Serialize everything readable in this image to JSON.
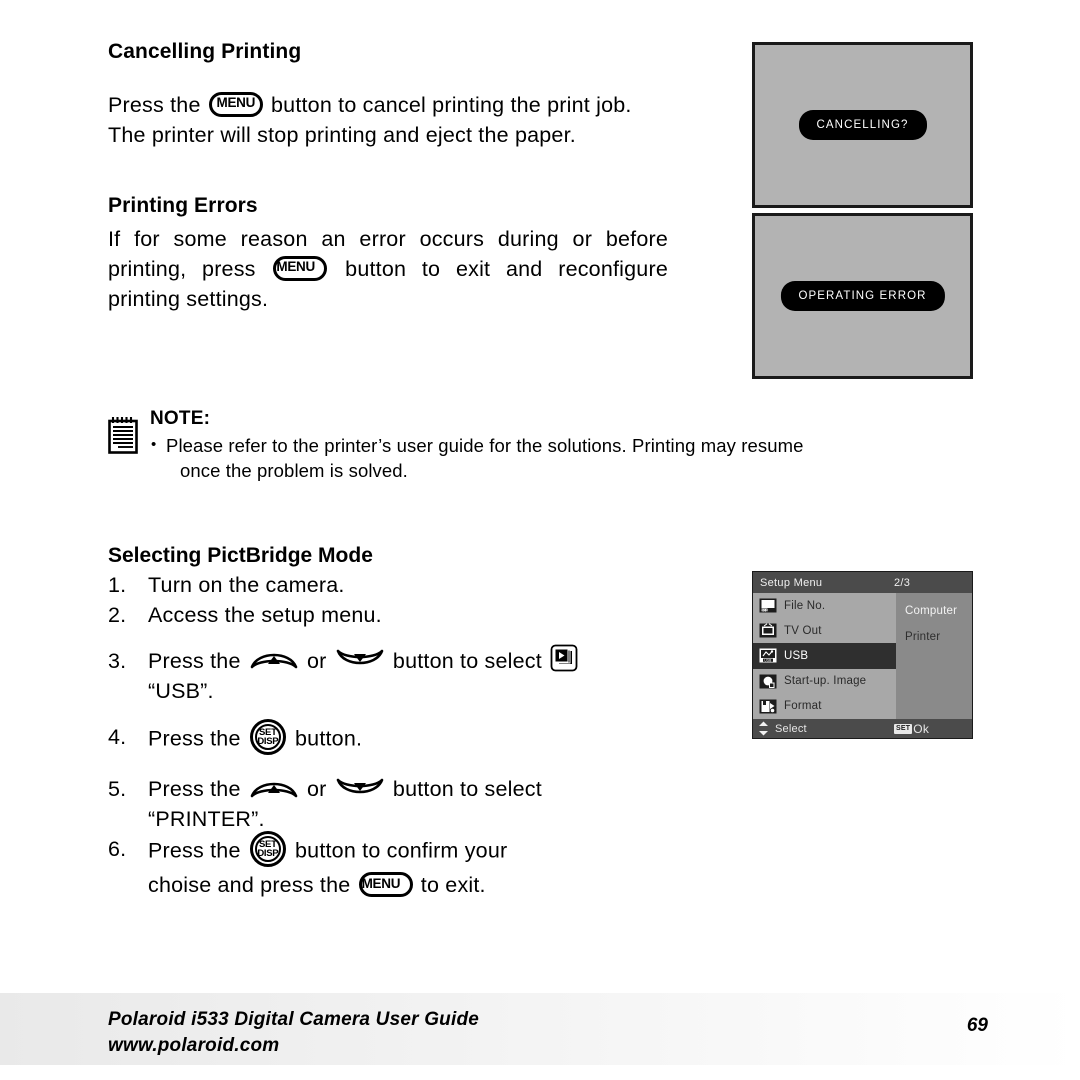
{
  "sections": {
    "cancelling": {
      "heading": "Cancelling Printing",
      "text_a": "Press the",
      "text_b": "button to cancel printing the print job. The printer will stop printing and eject the paper.",
      "menu_icon_label": "MENU"
    },
    "errors": {
      "heading": "Printing Errors",
      "text_a": "If for some reason an error occurs during or before printing, press",
      "text_b": "button to exit and reconfigure printing settings.",
      "menu_icon_label": "MENU"
    }
  },
  "note": {
    "title": "NOTE:",
    "bullet": "Please refer to the printer’s user guide for the solutions. Printing may resume",
    "bullet_cont": "once the problem is solved.",
    "icon": "notepad-icon"
  },
  "procedure": {
    "heading": "Selecting PictBridge Mode",
    "steps": [
      {
        "num": "1.",
        "text": "Turn on the camera."
      },
      {
        "num": "2.",
        "text": "Access the setup menu."
      },
      {
        "num": "3.",
        "pre": "Press the",
        "mid": "or",
        "post": "button to select",
        "sub": "“USB”."
      },
      {
        "num": "4.",
        "pre": "Press the",
        "post": "button."
      },
      {
        "num": "5.",
        "pre": "Press the",
        "mid": "or",
        "post": "button to select",
        "sub": "“PRINTER”."
      },
      {
        "num": "6.",
        "pre": "Press the",
        "post": "button to confirm your",
        "sub_pre": "choise and press the",
        "sub_post": "to exit."
      }
    ],
    "icons": {
      "up_button": "arrow-up-button-icon",
      "down_button": "arrow-down-button-icon",
      "setdisp_line1": "SET",
      "setdisp_line2": "DISP",
      "usb_select": "slideshow-stack-icon",
      "menu_label": "MENU"
    }
  },
  "lcd_screens": {
    "cancelling": {
      "message": "CANCELLING?"
    },
    "error": {
      "message": "OPERATING ERROR"
    }
  },
  "setup_menu": {
    "title": "Setup Menu",
    "page": "2/3",
    "items": [
      {
        "label": "File No.",
        "icon": "file-number-icon",
        "selected": false
      },
      {
        "label": "TV Out",
        "icon": "tv-out-icon",
        "selected": false
      },
      {
        "label": "USB",
        "icon": "usb-icon",
        "selected": true
      },
      {
        "label": "Start-up. Image",
        "icon": "startup-image-icon",
        "selected": false
      },
      {
        "label": "Format",
        "icon": "format-icon",
        "selected": false
      }
    ],
    "options": [
      "Computer",
      "Printer"
    ],
    "footer": {
      "select_label": "Select",
      "set_badge": "SET",
      "ok_label": "Ok",
      "updown_icon": "up-down-arrows-icon"
    }
  },
  "footer": {
    "line1": "Polaroid i533 Digital Camera User Guide",
    "line2": "www.polaroid.com",
    "page_number": "69"
  }
}
